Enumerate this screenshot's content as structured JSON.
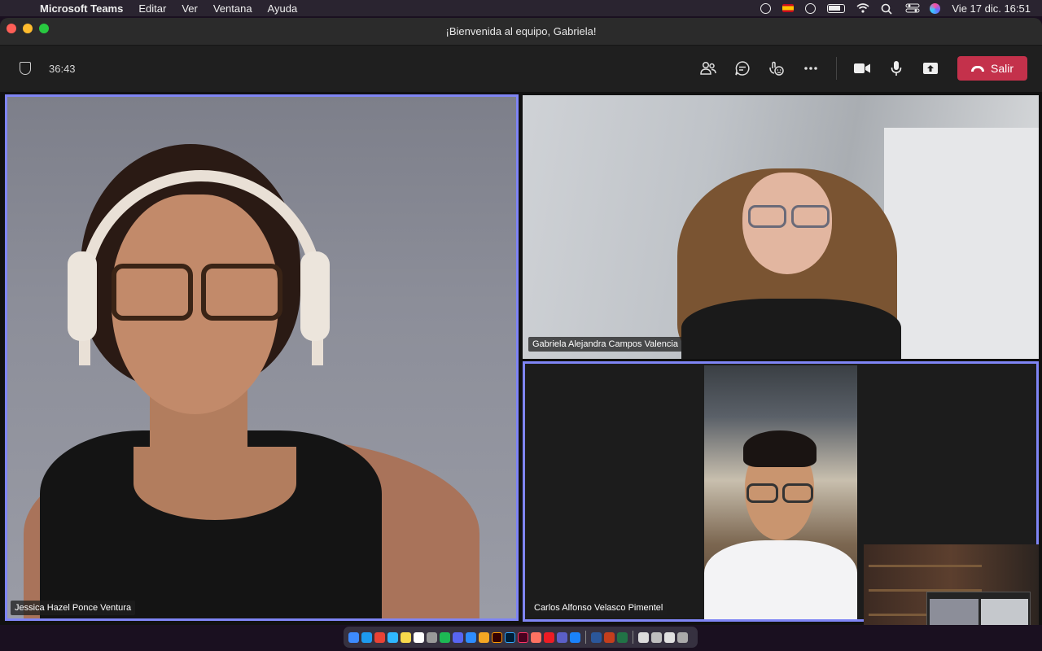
{
  "menubar": {
    "apple_symbol": "",
    "app_name": "Microsoft Teams",
    "menus": [
      "Editar",
      "Ver",
      "Ventana",
      "Ayuda"
    ],
    "datetime": "Vie 17 dic.  16:51",
    "status_icons": [
      "play-circle-icon",
      "spain-flag-icon",
      "info-icon",
      "battery-icon",
      "wifi-icon",
      "search-icon",
      "control-center-icon",
      "siri-icon"
    ]
  },
  "window": {
    "title": "¡Bienvenida al equipo, Gabriela!"
  },
  "toolbar": {
    "timer": "36:43",
    "leave_label": "Salir",
    "leave_color": "#c4314b",
    "buttons": [
      "participants-icon",
      "chat-icon",
      "reactions-icon",
      "more-options-icon",
      "camera-icon",
      "microphone-icon",
      "share-screen-icon"
    ]
  },
  "participants": [
    {
      "name": "Jessica Hazel Ponce Ventura",
      "active_speaker": true
    },
    {
      "name": "Gabriela Alejandra Campos Valencia",
      "active_speaker": false
    },
    {
      "name": "Carlos Alfonso Velasco Pimentel",
      "active_speaker": true
    }
  ],
  "accent_color": "#7f85f5",
  "dock": {
    "apps": [
      "finder",
      "app-store",
      "chrome",
      "messages",
      "notes",
      "calendar",
      "photos",
      "spotify",
      "discord",
      "zoom",
      "pages",
      "illustrator",
      "photoshop",
      "indesign",
      "figma",
      "acrobat",
      "teams",
      "keynote",
      "word",
      "excel",
      "powerpoint",
      "downloads",
      "preview",
      "trash"
    ]
  }
}
